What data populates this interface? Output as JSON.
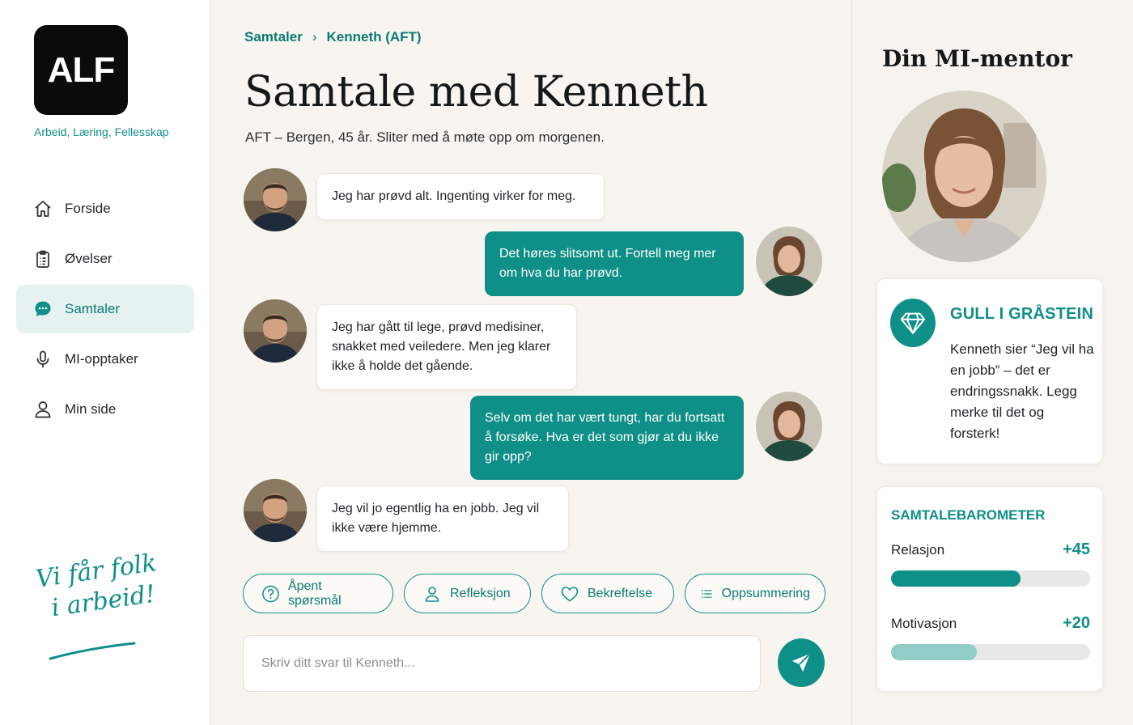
{
  "sidebar": {
    "logo_text": "ALF",
    "tagline": "Arbeid, Læring, Fellesskap",
    "nav": [
      {
        "label": "Forside",
        "icon": "home-icon"
      },
      {
        "label": "Øvelser",
        "icon": "clipboard-icon"
      },
      {
        "label": "Samtaler",
        "icon": "chat-icon",
        "active": true
      },
      {
        "label": "MI-opptaker",
        "icon": "microphone-icon"
      },
      {
        "label": "Min side",
        "icon": "user-icon"
      }
    ],
    "slogan": [
      "Vi får folk",
      "i arbeid!"
    ]
  },
  "main": {
    "breadcrumb": [
      "Samtaler",
      "Kenneth (AFT)"
    ],
    "title": "Samtale med Kenneth",
    "subtitle": "AFT – Bergen, 45 år. Sliter med å møte opp om morgenen.",
    "messages": [
      {
        "from": "client",
        "text": "Jeg har prøvd alt. Ingenting virker for meg."
      },
      {
        "from": "user",
        "text": "Det høres slitsomt ut. Fortell meg mer om hva du har prøvd."
      },
      {
        "from": "client",
        "text": "Jeg har gått til lege, prøvd medisiner, snakket med veiledere. Men jeg klarer ikke å holde det gående."
      },
      {
        "from": "user",
        "text": "Selv om det har vært tungt, har du fortsatt å forsøke. Hva er det som gjør at du ikke gir opp?"
      },
      {
        "from": "client",
        "text": "Jeg vil jo egentlig ha en jobb. Jeg vil ikke være hjemme."
      }
    ],
    "chips": [
      {
        "label": "Åpent spørsmål",
        "icon": "question-icon"
      },
      {
        "label": "Refleksjon",
        "icon": "person-icon"
      },
      {
        "label": "Bekreftelse",
        "icon": "heart-icon"
      },
      {
        "label": "Oppsummering",
        "icon": "list-icon"
      }
    ],
    "input_placeholder": "Skriv ditt svar til Kenneth..."
  },
  "right": {
    "mentor_title": "Din MI-mentor",
    "tip": {
      "title": "GULL I GRÅSTEIN",
      "text": "Kenneth sier “Jeg vil ha en jobb” – det er endringssnakk. Legg merke til det og forsterk!"
    },
    "barometer": {
      "title": "SAMTALEBAROMETER",
      "metrics": [
        {
          "label": "Relasjon",
          "value": "+45",
          "fill_pct": 65,
          "color": "#0e8f87"
        },
        {
          "label": "Motivasjon",
          "value": "+20",
          "fill_pct": 43,
          "color": "#8fcdc6"
        }
      ]
    }
  },
  "colors": {
    "accent": "#0e8f87",
    "accent_soft": "#e6f2f0"
  }
}
